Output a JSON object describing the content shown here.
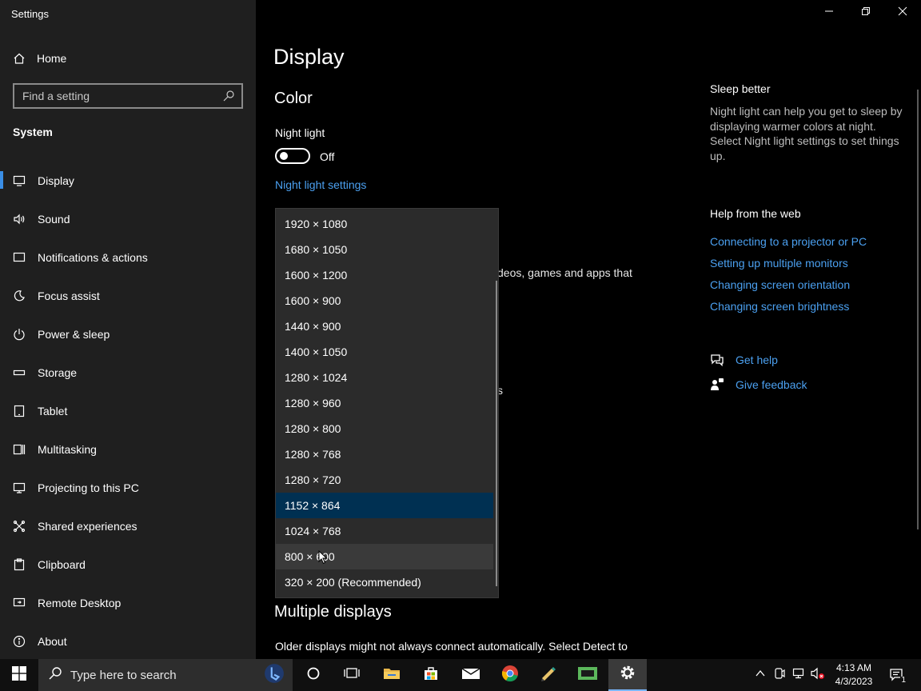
{
  "window": {
    "app_title": "Settings",
    "controls": [
      "minimize-icon",
      "restore-icon",
      "close-icon"
    ]
  },
  "sidebar": {
    "home_label": "Home",
    "search_placeholder": "Find a setting",
    "section_title": "System",
    "items": [
      {
        "label": "Display",
        "icon": "monitor-icon",
        "active": true
      },
      {
        "label": "Sound",
        "icon": "speaker-icon"
      },
      {
        "label": "Notifications & actions",
        "icon": "notification-icon"
      },
      {
        "label": "Focus assist",
        "icon": "moon-icon"
      },
      {
        "label": "Power & sleep",
        "icon": "power-icon"
      },
      {
        "label": "Storage",
        "icon": "storage-icon"
      },
      {
        "label": "Tablet",
        "icon": "tablet-icon"
      },
      {
        "label": "Multitasking",
        "icon": "multitasking-icon"
      },
      {
        "label": "Projecting to this PC",
        "icon": "projector-icon"
      },
      {
        "label": "Shared experiences",
        "icon": "shared-icon"
      },
      {
        "label": "Clipboard",
        "icon": "clipboard-icon"
      },
      {
        "label": "Remote Desktop",
        "icon": "remote-desktop-icon"
      },
      {
        "label": "About",
        "icon": "info-icon"
      }
    ]
  },
  "main": {
    "page_title": "Display",
    "color_heading": "Color",
    "night_light_label": "Night light",
    "night_light_state": "Off",
    "night_light_settings_link": "Night light settings",
    "partial_text": "deos, games and apps that",
    "partial_mark": "s",
    "multiple_displays_heading": "Multiple displays",
    "multiple_displays_desc": "Older displays might not always connect automatically. Select Detect to"
  },
  "resolution_dropdown": {
    "options": [
      "1920 × 1080",
      "1680 × 1050",
      "1600 × 1200",
      "1600 × 900",
      "1440 × 900",
      "1400 × 1050",
      "1280 × 1024",
      "1280 × 960",
      "1280 × 800",
      "1280 × 768",
      "1280 × 720",
      "1152 × 864",
      "1024 × 768",
      "800 × 600",
      "320 × 200 (Recommended)"
    ],
    "selected": "1152 × 864",
    "hovered": "800 × 600"
  },
  "right_panel": {
    "sleep_heading": "Sleep better",
    "sleep_text": "Night light can help you get to sleep by displaying warmer colors at night. Select Night light settings to set things up.",
    "help_heading": "Help from the web",
    "help_links": [
      "Connecting to a projector or PC",
      "Setting up multiple monitors",
      "Changing screen orientation",
      "Changing screen brightness"
    ],
    "get_help": "Get help",
    "give_feedback": "Give feedback"
  },
  "taskbar": {
    "search_placeholder": "Type here to search",
    "apps": [
      "cortana-icon",
      "task-view-icon",
      "file-explorer-icon",
      "store-icon",
      "mail-icon",
      "chrome-icon",
      "pen-app-icon",
      "green-app-icon",
      "settings-icon"
    ],
    "clock_time": "4:13 AM",
    "clock_date": "4/3/2023",
    "notification_count": "1"
  },
  "colors": {
    "accent_link": "#4ba0f0",
    "sidebar_bg": "#1f1f1f",
    "selected_bg": "#003052",
    "active_indicator": "#3a8ee6"
  }
}
